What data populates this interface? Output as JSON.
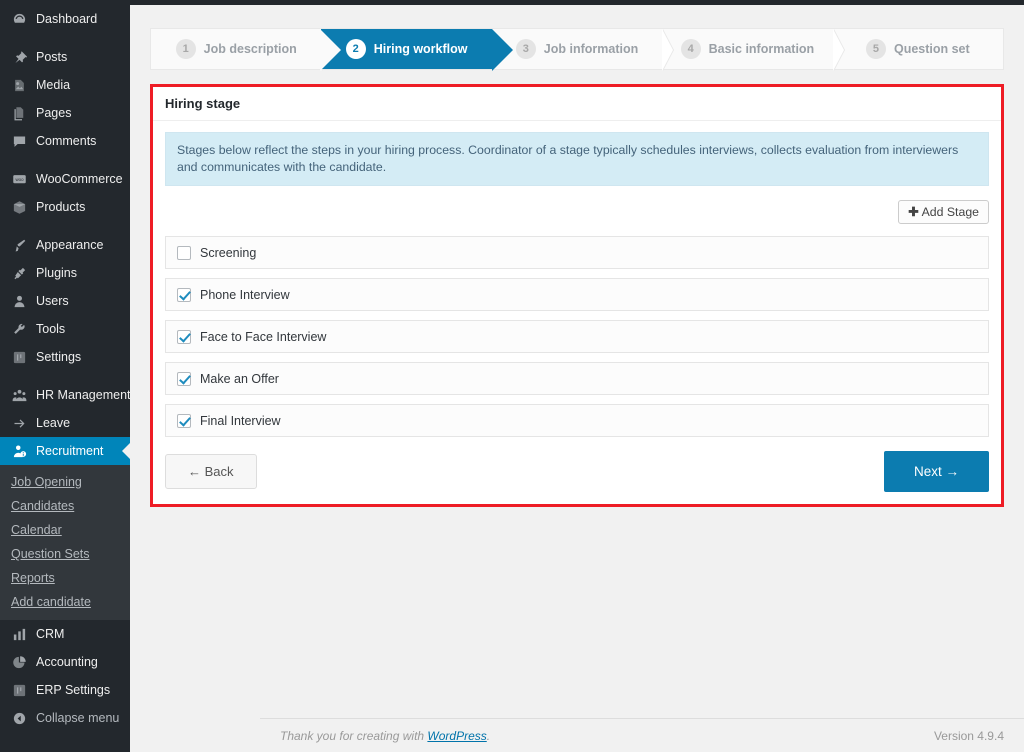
{
  "sidebar": {
    "items": [
      {
        "label": "Dashboard",
        "icon": "dashboard-icon",
        "type": "item"
      },
      {
        "type": "sep"
      },
      {
        "label": "Posts",
        "icon": "pin-icon",
        "type": "item"
      },
      {
        "label": "Media",
        "icon": "media-icon",
        "type": "item"
      },
      {
        "label": "Pages",
        "icon": "pages-icon",
        "type": "item"
      },
      {
        "label": "Comments",
        "icon": "comment-icon",
        "type": "item"
      },
      {
        "type": "sep"
      },
      {
        "label": "WooCommerce",
        "icon": "woocommerce-icon",
        "type": "item"
      },
      {
        "label": "Products",
        "icon": "products-icon",
        "type": "item"
      },
      {
        "type": "sep"
      },
      {
        "label": "Appearance",
        "icon": "brush-icon",
        "type": "item"
      },
      {
        "label": "Plugins",
        "icon": "plugin-icon",
        "type": "item"
      },
      {
        "label": "Users",
        "icon": "user-icon",
        "type": "item"
      },
      {
        "label": "Tools",
        "icon": "wrench-icon",
        "type": "item"
      },
      {
        "label": "Settings",
        "icon": "settings-icon",
        "type": "item"
      },
      {
        "type": "sep"
      },
      {
        "label": "HR Management",
        "icon": "group-icon",
        "type": "item"
      },
      {
        "label": "Leave",
        "icon": "arrow-right-icon",
        "type": "item"
      },
      {
        "label": "Recruitment",
        "icon": "recruitment-icon",
        "type": "item",
        "active": true
      }
    ],
    "submenu": [
      "Job Opening",
      "Candidates",
      "Calendar",
      "Question Sets",
      "Reports",
      "Add candidate"
    ],
    "items_bottom": [
      {
        "label": "CRM",
        "icon": "chart-bar-icon",
        "type": "item"
      },
      {
        "label": "Accounting",
        "icon": "pie-chart-icon",
        "type": "item"
      },
      {
        "label": "ERP Settings",
        "icon": "settings-icon",
        "type": "item"
      },
      {
        "label": "Collapse menu",
        "icon": "collapse-icon",
        "type": "collapse"
      }
    ]
  },
  "wizard": {
    "steps": [
      {
        "num": "1",
        "label": "Job description",
        "active": false
      },
      {
        "num": "2",
        "label": "Hiring workflow",
        "active": true
      },
      {
        "num": "3",
        "label": "Job information",
        "active": false
      },
      {
        "num": "4",
        "label": "Basic information",
        "active": false
      },
      {
        "num": "5",
        "label": "Question set",
        "active": false
      }
    ],
    "active_color": "#0c7cb0"
  },
  "panel": {
    "title": "Hiring stage",
    "highlight_color": "#ee1c25",
    "notice": "Stages below reflect the steps in your hiring process. Coordinator of a stage typically schedules interviews, collects evaluation from interviewers and communicates with the candidate.",
    "add_stage_label": "Add Stage",
    "add_stage_plus": "✚",
    "stages": [
      {
        "label": "Screening",
        "checked": false
      },
      {
        "label": "Phone Interview",
        "checked": true
      },
      {
        "label": "Face to Face Interview",
        "checked": true
      },
      {
        "label": "Make an Offer",
        "checked": true
      },
      {
        "label": "Final Interview",
        "checked": true
      }
    ],
    "back_label": "← Back",
    "next_label": "Next →"
  },
  "footer": {
    "thanks_prefix": "Thank you for creating with ",
    "wordpress_link": "WordPress",
    "thanks_suffix": ".",
    "version": "Version 4.9.4"
  }
}
